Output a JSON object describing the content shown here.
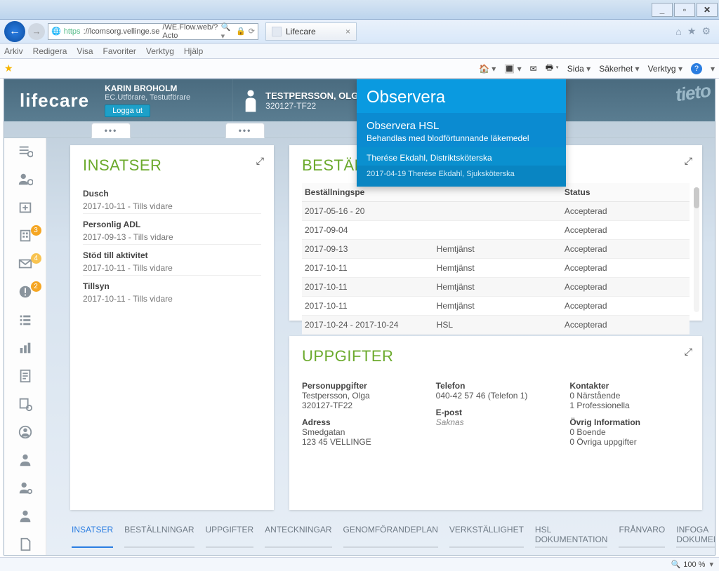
{
  "browser": {
    "url_proto": "https",
    "url_host": "://lcomsorg.vellinge.se",
    "url_path": "/WE.Flow.web/?Acto",
    "tab_title": "Lifecare",
    "menu": [
      "Arkiv",
      "Redigera",
      "Visa",
      "Favoriter",
      "Verktyg",
      "Hjälp"
    ],
    "ie_tools": {
      "page": "Sida",
      "safety": "Säkerhet",
      "tools": "Verktyg"
    },
    "zoom": "100 %"
  },
  "app": {
    "brand": "lifecare",
    "user": {
      "name": "KARIN BROHOLM",
      "role": "EC.Utförare, Testutförare",
      "logout": "Logga ut"
    },
    "patient": {
      "name": "TESTPERSSON, OLGA",
      "id": "320127-TF22"
    },
    "corner": "tieto",
    "sidebar_badges": {
      "building": "3",
      "mail": "4",
      "alert": "2"
    }
  },
  "insatser": {
    "title": "INSATSER",
    "items": [
      {
        "title": "Dusch",
        "date": "2017-10-11  -  Tills vidare"
      },
      {
        "title": "Personlig ADL",
        "date": "2017-09-13  -  Tills vidare"
      },
      {
        "title": "Stöd till aktivitet",
        "date": "2017-10-11  -  Tills vidare"
      },
      {
        "title": "Tillsyn",
        "date": "2017-10-11  -  Tills vidare"
      }
    ]
  },
  "bestall": {
    "title": "BESTÄLL",
    "col1": "Beställningspe",
    "col2_hidden": "",
    "col3": "Status",
    "rows": [
      {
        "d": "2017-05-16 - 20",
        "t": "",
        "s": "Accepterad"
      },
      {
        "d": "2017-09-04",
        "t": "",
        "s": "Accepterad"
      },
      {
        "d": "2017-09-13",
        "t": "Hemtjänst",
        "s": "Accepterad"
      },
      {
        "d": "2017-10-11",
        "t": "Hemtjänst",
        "s": "Accepterad"
      },
      {
        "d": "2017-10-11",
        "t": "Hemtjänst",
        "s": "Accepterad"
      },
      {
        "d": "2017-10-11",
        "t": "Hemtjänst",
        "s": "Accepterad"
      },
      {
        "d": "2017-10-24 - 2017-10-24",
        "t": "HSL",
        "s": "Accepterad"
      }
    ]
  },
  "uppgifter": {
    "title": "UPPGIFTER",
    "person_h": "Personuppgifter",
    "person_name": "Testpersson, Olga",
    "person_id": "320127-TF22",
    "adress_h": "Adress",
    "adress_1": "Smedgatan",
    "adress_2": "123 45  VELLINGE",
    "tel_h": "Telefon",
    "tel": "040-42 57 46 (Telefon 1)",
    "epost_h": "E-post",
    "epost": "Saknas",
    "kont_h": "Kontakter",
    "kont_1": "0 Närstående",
    "kont_2": "1 Professionella",
    "ovrig_h": "Övrig Information",
    "ovrig_1": "0 Boende",
    "ovrig_2": "0 Övriga uppgifter"
  },
  "observera": {
    "header": "Observera",
    "title": "Observera HSL",
    "sub": "Behandlas med blodförtunnande läkemedel",
    "author": "Therése Ekdahl, Distriktsköterska",
    "meta": "2017-04-19  Therése Ekdahl,  Sjuksköterska"
  },
  "bottom_links": [
    "INSATSER",
    "BESTÄLLNINGAR",
    "UPPGIFTER",
    "ANTECKNINGAR",
    "GENOMFÖRANDEPLAN",
    "VERKSTÄLLIGHET",
    "HSL DOKUMENTATION",
    "FRÅNVARO",
    "INFOGA DOKUMENT"
  ]
}
